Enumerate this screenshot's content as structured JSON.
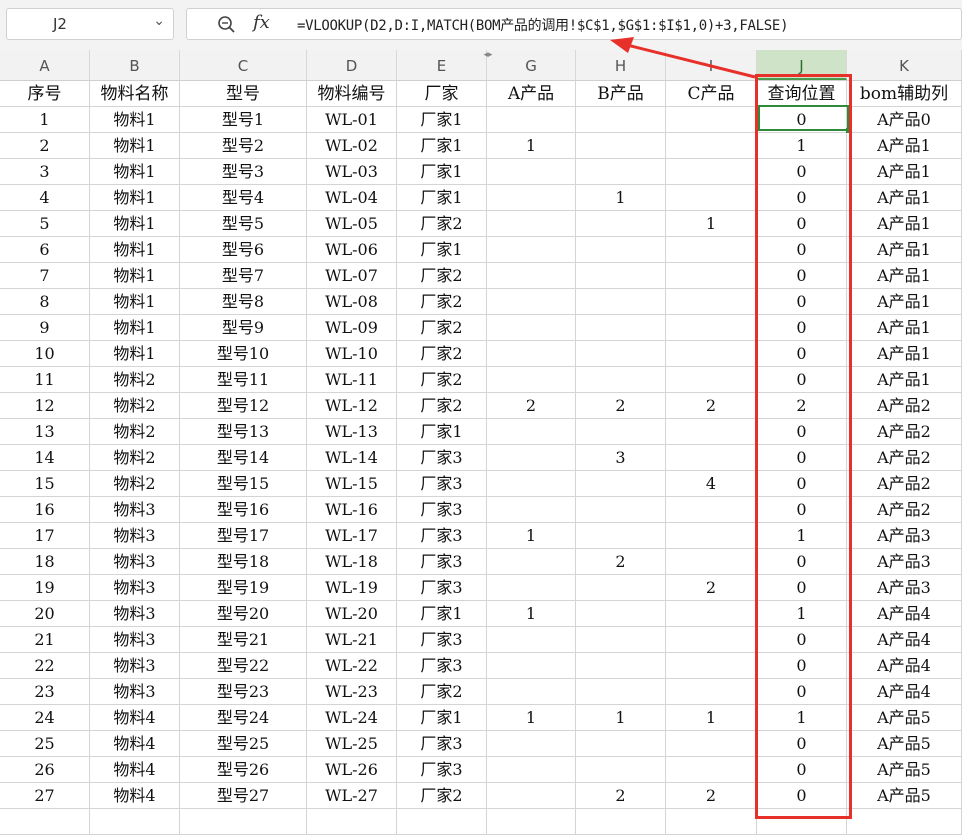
{
  "name_box": {
    "value": "J2"
  },
  "formula_bar": {
    "formula": "=VLOOKUP(D2,D:I,MATCH(BOM产品的调用!$C$1,$G$1:$I$1,0)+3,FALSE)",
    "fx_label": "fx"
  },
  "columns": [
    "A",
    "B",
    "C",
    "D",
    "E",
    "G",
    "H",
    "I",
    "J",
    "K"
  ],
  "selected_column": "J",
  "header": [
    "序号",
    "物料名称",
    "型号",
    "物料编号",
    "厂家",
    "A产品",
    "B产品",
    "C产品",
    "查询位置",
    "bom辅助列"
  ],
  "rows": [
    [
      "1",
      "物料1",
      "型号1",
      "WL-01",
      "厂家1",
      "",
      "",
      "",
      "0",
      "A产品0"
    ],
    [
      "2",
      "物料1",
      "型号2",
      "WL-02",
      "厂家1",
      "1",
      "",
      "",
      "1",
      "A产品1"
    ],
    [
      "3",
      "物料1",
      "型号3",
      "WL-03",
      "厂家1",
      "",
      "",
      "",
      "0",
      "A产品1"
    ],
    [
      "4",
      "物料1",
      "型号4",
      "WL-04",
      "厂家1",
      "",
      "1",
      "",
      "0",
      "A产品1"
    ],
    [
      "5",
      "物料1",
      "型号5",
      "WL-05",
      "厂家2",
      "",
      "",
      "1",
      "0",
      "A产品1"
    ],
    [
      "6",
      "物料1",
      "型号6",
      "WL-06",
      "厂家1",
      "",
      "",
      "",
      "0",
      "A产品1"
    ],
    [
      "7",
      "物料1",
      "型号7",
      "WL-07",
      "厂家2",
      "",
      "",
      "",
      "0",
      "A产品1"
    ],
    [
      "8",
      "物料1",
      "型号8",
      "WL-08",
      "厂家2",
      "",
      "",
      "",
      "0",
      "A产品1"
    ],
    [
      "9",
      "物料1",
      "型号9",
      "WL-09",
      "厂家2",
      "",
      "",
      "",
      "0",
      "A产品1"
    ],
    [
      "10",
      "物料1",
      "型号10",
      "WL-10",
      "厂家2",
      "",
      "",
      "",
      "0",
      "A产品1"
    ],
    [
      "11",
      "物料2",
      "型号11",
      "WL-11",
      "厂家2",
      "",
      "",
      "",
      "0",
      "A产品1"
    ],
    [
      "12",
      "物料2",
      "型号12",
      "WL-12",
      "厂家2",
      "2",
      "2",
      "2",
      "2",
      "A产品2"
    ],
    [
      "13",
      "物料2",
      "型号13",
      "WL-13",
      "厂家1",
      "",
      "",
      "",
      "0",
      "A产品2"
    ],
    [
      "14",
      "物料2",
      "型号14",
      "WL-14",
      "厂家3",
      "",
      "3",
      "",
      "0",
      "A产品2"
    ],
    [
      "15",
      "物料2",
      "型号15",
      "WL-15",
      "厂家3",
      "",
      "",
      "4",
      "0",
      "A产品2"
    ],
    [
      "16",
      "物料3",
      "型号16",
      "WL-16",
      "厂家3",
      "",
      "",
      "",
      "0",
      "A产品2"
    ],
    [
      "17",
      "物料3",
      "型号17",
      "WL-17",
      "厂家3",
      "1",
      "",
      "",
      "1",
      "A产品3"
    ],
    [
      "18",
      "物料3",
      "型号18",
      "WL-18",
      "厂家3",
      "",
      "2",
      "",
      "0",
      "A产品3"
    ],
    [
      "19",
      "物料3",
      "型号19",
      "WL-19",
      "厂家3",
      "",
      "",
      "2",
      "0",
      "A产品3"
    ],
    [
      "20",
      "物料3",
      "型号20",
      "WL-20",
      "厂家1",
      "1",
      "",
      "",
      "1",
      "A产品4"
    ],
    [
      "21",
      "物料3",
      "型号21",
      "WL-21",
      "厂家3",
      "",
      "",
      "",
      "0",
      "A产品4"
    ],
    [
      "22",
      "物料3",
      "型号22",
      "WL-22",
      "厂家3",
      "",
      "",
      "",
      "0",
      "A产品4"
    ],
    [
      "23",
      "物料3",
      "型号23",
      "WL-23",
      "厂家2",
      "",
      "",
      "",
      "0",
      "A产品4"
    ],
    [
      "24",
      "物料4",
      "型号24",
      "WL-24",
      "厂家1",
      "1",
      "1",
      "1",
      "1",
      "A产品5"
    ],
    [
      "25",
      "物料4",
      "型号25",
      "WL-25",
      "厂家3",
      "",
      "",
      "",
      "0",
      "A产品5"
    ],
    [
      "26",
      "物料4",
      "型号26",
      "WL-26",
      "厂家3",
      "",
      "",
      "",
      "0",
      "A产品5"
    ],
    [
      "27",
      "物料4",
      "型号27",
      "WL-27",
      "厂家2",
      "",
      "2",
      "2",
      "0",
      "A产品5"
    ]
  ],
  "colors": {
    "highlight_red": "#e8302a",
    "selection_green": "#2f8a3a"
  }
}
